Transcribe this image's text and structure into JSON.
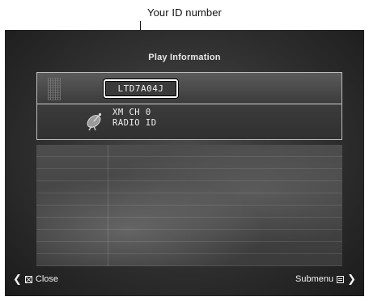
{
  "callout": {
    "label": "Your ID number"
  },
  "screen": {
    "title": "Play Information",
    "radio_id": "LTD7A04J",
    "channel_line": "XM CH 0",
    "radio_id_line": "RADIO ID",
    "icons": {
      "satellite": "satellite-dish-icon"
    }
  },
  "footer": {
    "close_label": "Close",
    "submenu_label": "Submenu"
  }
}
